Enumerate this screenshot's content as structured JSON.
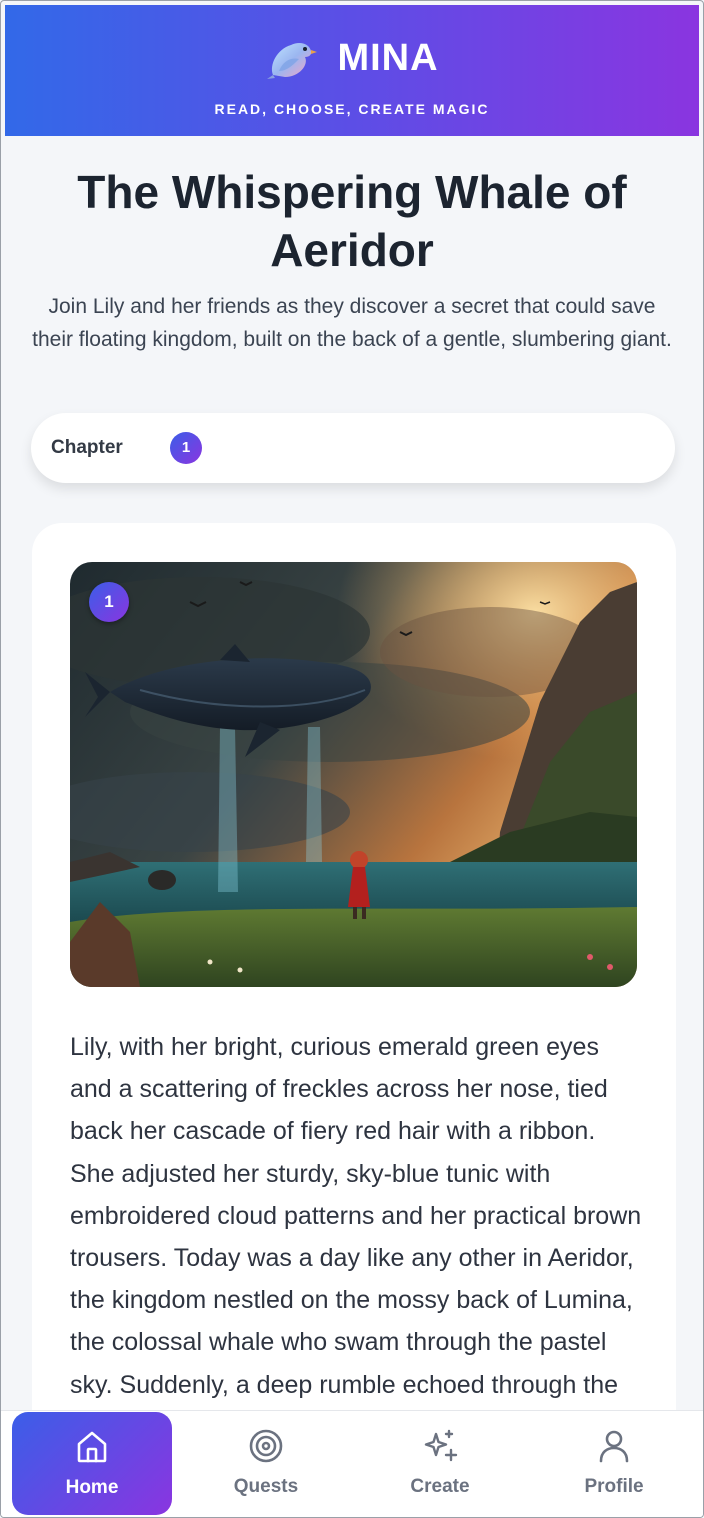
{
  "header": {
    "brand_name": "MINA",
    "tagline": "READ, CHOOSE, CREATE MAGIC",
    "logo_icon": "bird-icon"
  },
  "story": {
    "title": "The Whispering Whale of Aeridor",
    "subtitle": "Join Lily and her friends as they discover a secret that could save their floating kingdom, built on the back of a gentle, slumbering giant.",
    "chapter_label": "Chapter",
    "chapter_number": "1",
    "page_number": "1",
    "body": "Lily, with her bright, curious emerald green eyes and a scattering of freckles across her nose, tied back her cascade of fiery red hair with a ribbon. She adjusted her sturdy, sky-blue tunic with embroidered cloud patterns and her practical brown trousers. Today was a day like any other in Aeridor, the kingdom nestled on the mossy back of Lumina, the colossal whale who swam through the pastel sky. Suddenly, a deep rumble echoed through the land."
  },
  "nav": {
    "items": [
      {
        "label": "Home",
        "icon": "home-icon",
        "active": true
      },
      {
        "label": "Quests",
        "icon": "target-icon",
        "active": false
      },
      {
        "label": "Create",
        "icon": "sparkles-icon",
        "active": false
      },
      {
        "label": "Profile",
        "icon": "user-icon",
        "active": false
      }
    ]
  },
  "colors": {
    "gradient_start": "#3269e8",
    "gradient_end": "#8a35e0",
    "background": "#f4f6f9"
  }
}
